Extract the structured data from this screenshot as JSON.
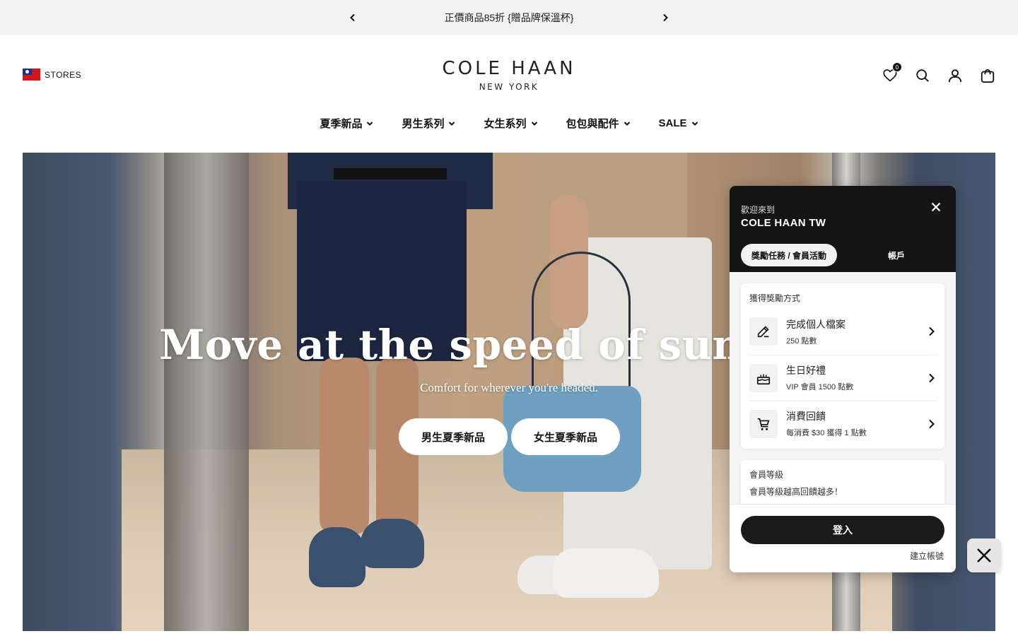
{
  "announcement": {
    "message": "正價商品85折 {贈品牌保溫杯}",
    "prev_icon": "chevron-left-icon",
    "next_icon": "chevron-right-icon"
  },
  "header": {
    "stores_label": "STORES",
    "logo_line1": "COLE HAAN",
    "logo_line2": "NEW YORK",
    "wishlist_count": "0",
    "icons": [
      "heart-icon",
      "search-icon",
      "user-icon",
      "bag-icon"
    ]
  },
  "nav": {
    "items": [
      {
        "label": "夏季新品"
      },
      {
        "label": "男生系列"
      },
      {
        "label": "女生系列"
      },
      {
        "label": "包包與配件"
      },
      {
        "label": "SALE"
      }
    ]
  },
  "hero": {
    "title": "Move at the speed of summer.",
    "subtitle": "Comfort for wherever you're headed.",
    "buttons": [
      {
        "label": "男生夏季新品"
      },
      {
        "label": "女生夏季新品"
      }
    ]
  },
  "rewards_panel": {
    "welcome": "歡迎來到",
    "store_name": "COLE HAAN TW",
    "tabs": {
      "active": "獎勵任務 / 會員活動",
      "other": "帳戶"
    },
    "ways_title": "獲得獎勵方式",
    "ways": [
      {
        "title": "完成個人檔案",
        "desc": "250 點數",
        "icon": "pencil-icon"
      },
      {
        "title": "生日好禮",
        "desc": "VIP 會員 1500 點數",
        "icon": "cake-icon"
      },
      {
        "title": "消費回饋",
        "desc": "每消費 $30 獲得 1 點數",
        "icon": "cart-icon"
      }
    ],
    "tier_title": "會員等級",
    "tier_desc": "會員等級越高回饋越多！",
    "login_label": "登入",
    "create_label": "建立帳號"
  },
  "colors": {
    "panel_header": "#151515",
    "accent": "#1a1a1a",
    "announce_bg": "#f2f2f2"
  }
}
